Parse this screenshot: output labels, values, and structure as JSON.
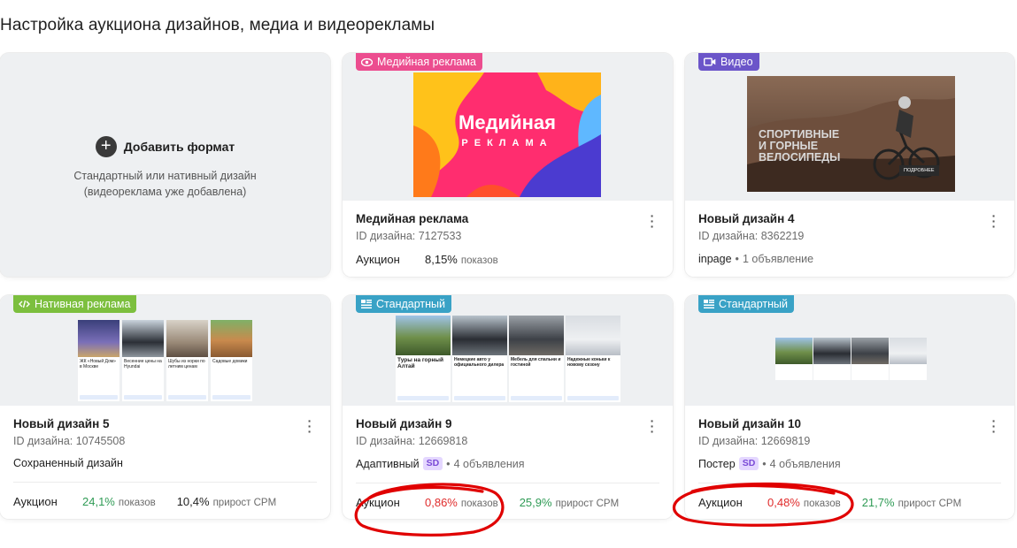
{
  "page": {
    "title": "Настройка аукциона дизайнов, медиа и видеорекламы"
  },
  "add_format": {
    "title": "Добавить формат",
    "subtitle_line1": "Стандартный или нативный дизайн",
    "subtitle_line2": "(видеореклама уже добавлена)"
  },
  "cards": [
    {
      "badge": "Медийная реклама",
      "title": "Медийная реклама",
      "id_text": "ID дизайна: 7127533",
      "auction_label": "Аукцион",
      "share": "8,15%",
      "share_unit": "показов",
      "banner_line1": "Медийная",
      "banner_line2": "РЕКЛАМА"
    },
    {
      "badge": "Видео",
      "title": "Новый дизайн 4",
      "id_text": "ID дизайна: 8362219",
      "format": "inpage",
      "count": "1 объявление",
      "video_line1": "СПОРТИВНЫЕ",
      "video_line2": "И ГОРНЫЕ",
      "video_line3": "ВЕЛОСИПЕДЫ",
      "video_btn": "ПОДРОБНЕЕ"
    },
    {
      "badge": "Нативная реклама",
      "title": "Новый дизайн 5",
      "id_text": "ID дизайна: 10745508",
      "status": "Сохраненный дизайн",
      "auction_label": "Аукцион",
      "share": "24,1%",
      "share_unit": "показов",
      "lift": "10,4%",
      "lift_unit": "прирост CPM",
      "thumbs": [
        "ЖК «Новый Дом» в Москве",
        "Весенние цены на Hyundai",
        "Шубы из норки по летним ценам",
        "Садовые домики"
      ]
    },
    {
      "badge": "Стандартный",
      "title": "Новый дизайн 9",
      "id_text": "ID дизайна: 12669818",
      "format": "Адаптивный",
      "sd": "SD",
      "count": "4 объявления",
      "auction_label": "Аукцион",
      "share": "0,86%",
      "share_unit": "показов",
      "lift": "25,9%",
      "lift_unit": "прирост CPM",
      "thumbs": [
        "Туры на горный Алтай",
        "Немецкие авто у официального дилера",
        "Мебель для спальни и гостиной",
        "Надежные коньки к новому сезону"
      ]
    },
    {
      "badge": "Стандартный",
      "title": "Новый дизайн 10",
      "id_text": "ID дизайна: 12669819",
      "format": "Постер",
      "sd": "SD",
      "count": "4 объявления",
      "auction_label": "Аукцион",
      "share": "0,48%",
      "share_unit": "показов",
      "lift": "21,7%",
      "lift_unit": "прирост CPM"
    }
  ],
  "colors": {
    "accent_green": "#2f9b55",
    "alert_red": "#e02b2b",
    "badge_media": "#ec4d8f",
    "badge_video": "#6b55c9",
    "badge_native": "#7cbf3e",
    "badge_standard": "#39a2c6"
  },
  "icons": {
    "add": "plus-circle-icon",
    "media_badge": "eye-icon",
    "video_badge": "video-camera-icon",
    "native_badge": "code-icon",
    "standard_badge": "layout-icon",
    "menu": "kebab-menu-icon"
  }
}
